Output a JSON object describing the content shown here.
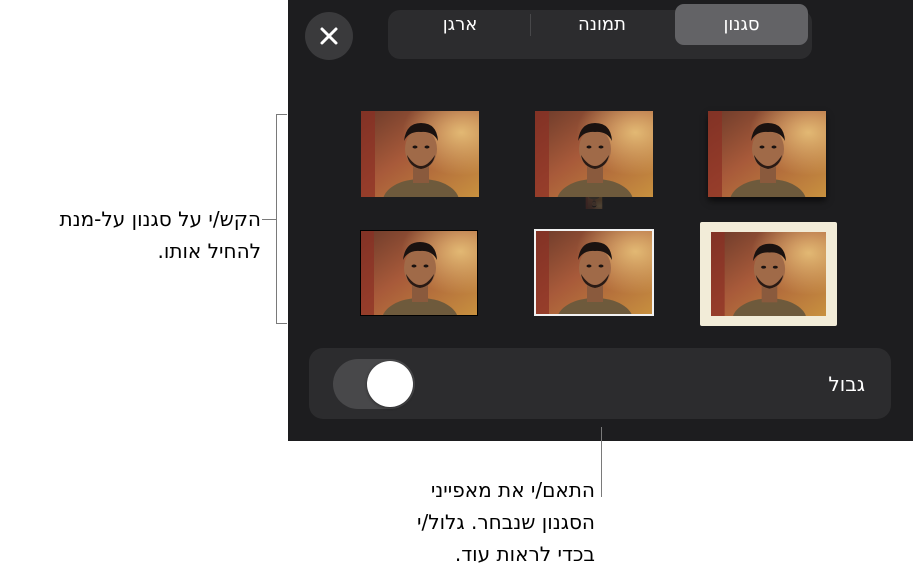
{
  "tabs": [
    {
      "label": "סגנון",
      "active": true
    },
    {
      "label": "תמונה",
      "active": false
    },
    {
      "label": "ארגן",
      "active": false
    }
  ],
  "close_icon": "close-icon",
  "styles": {
    "count": 6,
    "selected_index": 5
  },
  "border": {
    "label": "גבול",
    "enabled": true
  },
  "callouts": {
    "styles_note_line1": "הקש/י על סגנון על-מנת",
    "styles_note_line2": "להחיל אותו.",
    "border_note_line1": "התאם/י את מאפייני",
    "border_note_line2": "הסגנון שנבחר. גלול/י",
    "border_note_line3": "בכדי לראות עוד."
  },
  "colors": {
    "panel": "#1d1d1f",
    "control": "#2c2c2e",
    "active_tab": "#636366"
  }
}
